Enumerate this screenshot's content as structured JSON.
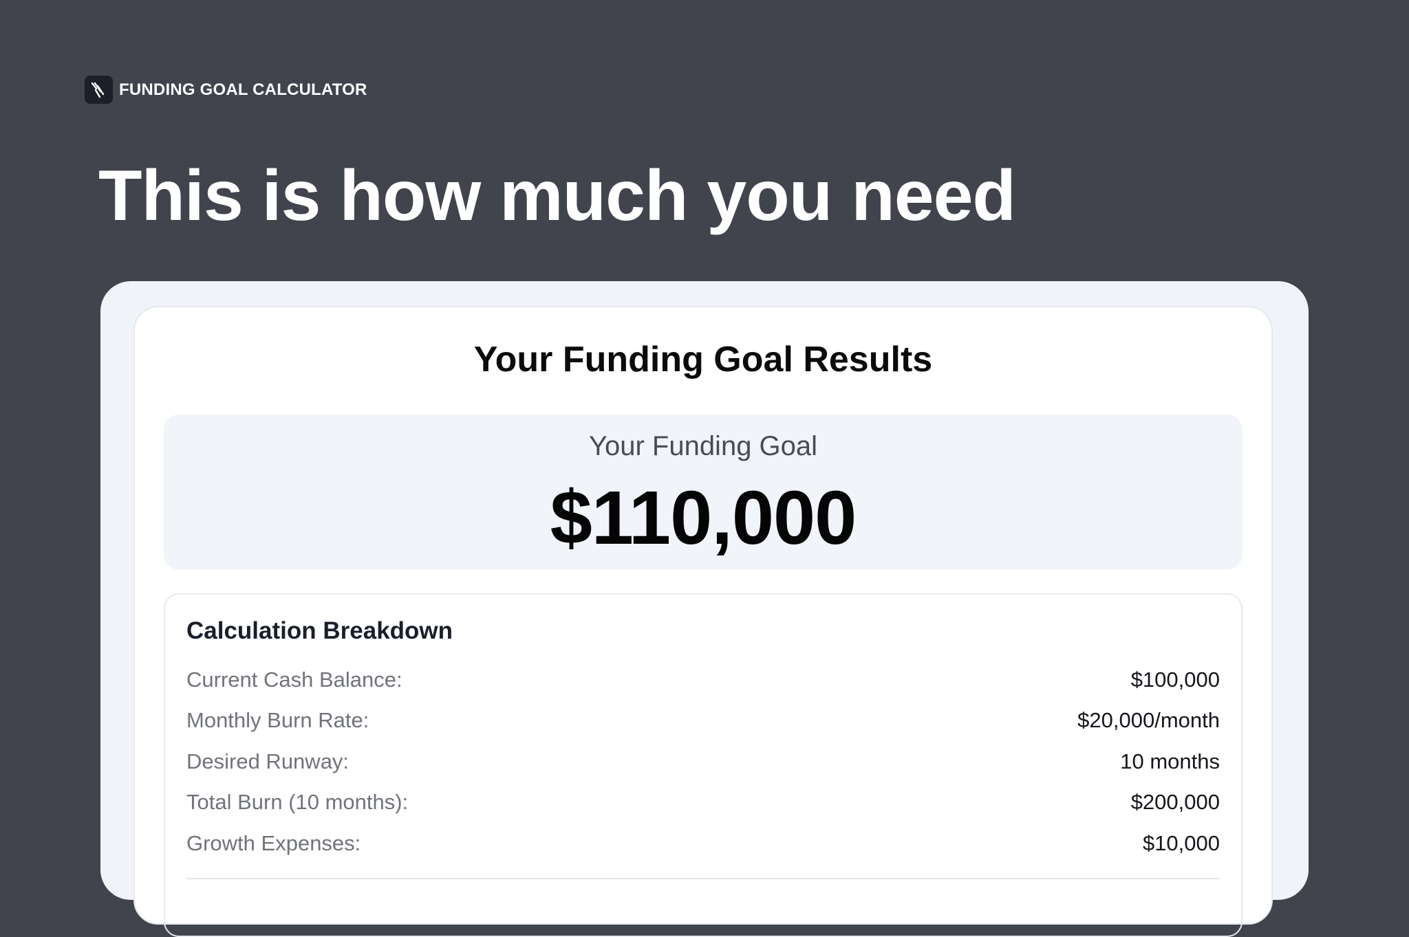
{
  "header": {
    "brand_label": "FUNDING GOAL CALCULATOR",
    "brand_icon": "stripes-logo-icon",
    "title": "This is how much you need"
  },
  "results": {
    "title": "Your Funding Goal Results",
    "goal_label": "Your Funding Goal",
    "goal_value": "$110,000"
  },
  "breakdown": {
    "title": "Calculation Breakdown",
    "rows": [
      {
        "label": "Current Cash Balance:",
        "value": "$100,000"
      },
      {
        "label": "Monthly Burn Rate:",
        "value": "$20,000/month"
      },
      {
        "label": "Desired Runway:",
        "value": "10 months"
      },
      {
        "label": "Total Burn (10 months):",
        "value": "$200,000"
      },
      {
        "label": "Growth Expenses:",
        "value": "$10,000"
      }
    ]
  },
  "colors": {
    "page_background": "#41444c",
    "card_background": "#f0f3f8",
    "panel_background": "#ffffff",
    "icon_background": "#1c1f27"
  }
}
